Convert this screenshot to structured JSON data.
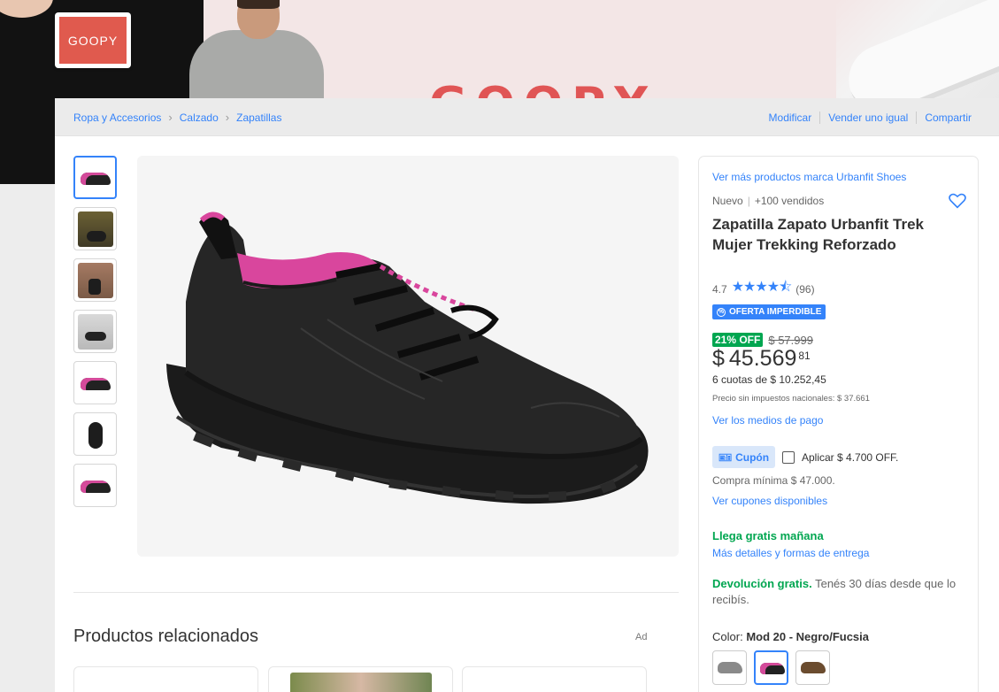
{
  "banner": {
    "logo_text": "GOOPY",
    "banner_word": "GOOPY"
  },
  "breadcrumb": [
    {
      "label": "Ropa y Accesorios"
    },
    {
      "label": "Calzado"
    },
    {
      "label": "Zapatillas"
    }
  ],
  "top_actions": {
    "edit": "Modificar",
    "sell_same": "Vender uno igual",
    "share": "Compartir"
  },
  "gallery": {
    "thumbnails": [
      "shoe-side",
      "worn-forest",
      "worn-brick",
      "shoe-rock",
      "shoe-front",
      "shoe-back",
      "shoe-side-2"
    ],
    "selected_index": 0
  },
  "product": {
    "brand_link": "Ver más productos marca Urbanfit Shoes",
    "condition": "Nuevo",
    "sold": "+100 vendidos",
    "title": "Zapatilla Zapato Urbanfit Trek Mujer Trekking Reforzado",
    "rating_value": "4.7",
    "rating_stars": "★★★★⯪",
    "rating_count": "(96)",
    "deal_badge": "OFERTA IMPERDIBLE",
    "discount": "21% OFF",
    "old_price": "$ 57.999",
    "price_currency": "$",
    "price_int": "45.569",
    "price_cents": "81",
    "installments": "6 cuotas de $ 10.252,45",
    "price_no_tax": "Precio sin impuestos nacionales: $ 37.661",
    "payment_link": "Ver los medios de pago"
  },
  "coupon": {
    "tag": "Cupón",
    "apply_text": "Aplicar $ 4.700 OFF.",
    "min_purchase": "Compra mínima $ 47.000.",
    "see_coupons": "Ver cupones disponibles"
  },
  "shipping": {
    "arrival": "Llega gratis mañana",
    "details_link": "Más detalles y formas de entrega"
  },
  "returns": {
    "bold": "Devolución gratis.",
    "text": "Tenés 30 días desde que lo recibís."
  },
  "variants": {
    "label": "Color:",
    "selected": "Mod 20 - Negro/Fucsia",
    "options": [
      "gray",
      "black-fuchsia",
      "brown"
    ]
  },
  "related": {
    "title": "Productos relacionados",
    "ad": "Ad"
  },
  "colors": {
    "accent": "#3483fa",
    "green": "#00a650",
    "banner_red": "#e05a4e"
  }
}
